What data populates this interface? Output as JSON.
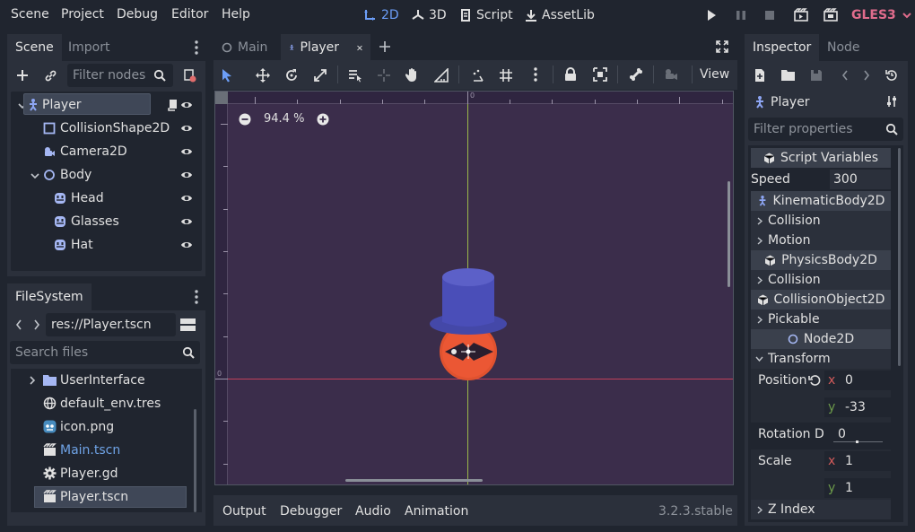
{
  "menu": {
    "items": [
      "Scene",
      "Project",
      "Debug",
      "Editor",
      "Help"
    ]
  },
  "workspaces": {
    "2d": "2D",
    "3d": "3D",
    "script": "Script",
    "assetlib": "AssetLib"
  },
  "renderer": "GLES3",
  "scene_dock": {
    "tabs": [
      "Scene",
      "Import"
    ],
    "filter_placeholder": "Filter nodes",
    "nodes": [
      {
        "label": "Player",
        "icon": "kinematic-body-icon"
      },
      {
        "label": "CollisionShape2D",
        "icon": "collision-shape-icon"
      },
      {
        "label": "Camera2D",
        "icon": "camera-icon"
      },
      {
        "label": "Body",
        "icon": "node2d-icon"
      },
      {
        "label": "Head",
        "icon": "sprite-icon"
      },
      {
        "label": "Glasses",
        "icon": "sprite-icon"
      },
      {
        "label": "Hat",
        "icon": "sprite-icon"
      }
    ]
  },
  "filesystem": {
    "title": "FileSystem",
    "path": "res://Player.tscn",
    "search_placeholder": "Search files",
    "items": [
      {
        "label": "UserInterface",
        "icon": "folder-icon"
      },
      {
        "label": "default_env.tres",
        "icon": "environment-icon"
      },
      {
        "label": "icon.png",
        "icon": "image-icon"
      },
      {
        "label": "Main.tscn",
        "icon": "scene-icon"
      },
      {
        "label": "Player.gd",
        "icon": "gear-icon"
      },
      {
        "label": "Player.tscn",
        "icon": "scene-icon"
      }
    ]
  },
  "editor_tabs": [
    "Main",
    "Player"
  ],
  "toolbar": {
    "view_label": "View"
  },
  "viewport": {
    "zoom": "94.4 %",
    "ruler_zero": "0"
  },
  "bottom_tabs": [
    "Output",
    "Debugger",
    "Audio",
    "Animation"
  ],
  "version": "3.2.3.stable",
  "inspector": {
    "tabs": [
      "Inspector",
      "Node"
    ],
    "object": "Player",
    "filter_placeholder": "Filter properties",
    "script_variables": "Script Variables",
    "speed_label": "Speed",
    "speed_value": "300",
    "kinematic": "KinematicBody2D",
    "collision1": "Collision",
    "motion": "Motion",
    "physics": "PhysicsBody2D",
    "collision2": "Collision",
    "collision_object": "CollisionObject2D",
    "pickable": "Pickable",
    "node2d": "Node2D",
    "transform": "Transform",
    "position_label": "Position",
    "pos_x": "0",
    "pos_y": "-33",
    "rotation_label": "Rotation D",
    "rotation_value": "0",
    "scale_label": "Scale",
    "scale_x": "1",
    "scale_y": "1",
    "z_index": "Z Index",
    "axis_x": "x",
    "axis_y": "y"
  },
  "colors": {
    "accent": "#6c9ef8",
    "bg": "#20252f",
    "panel": "#2b303b",
    "canvas": "#3b2d4b",
    "link": "#6fa3e6",
    "renderer": "#e06c8c"
  }
}
